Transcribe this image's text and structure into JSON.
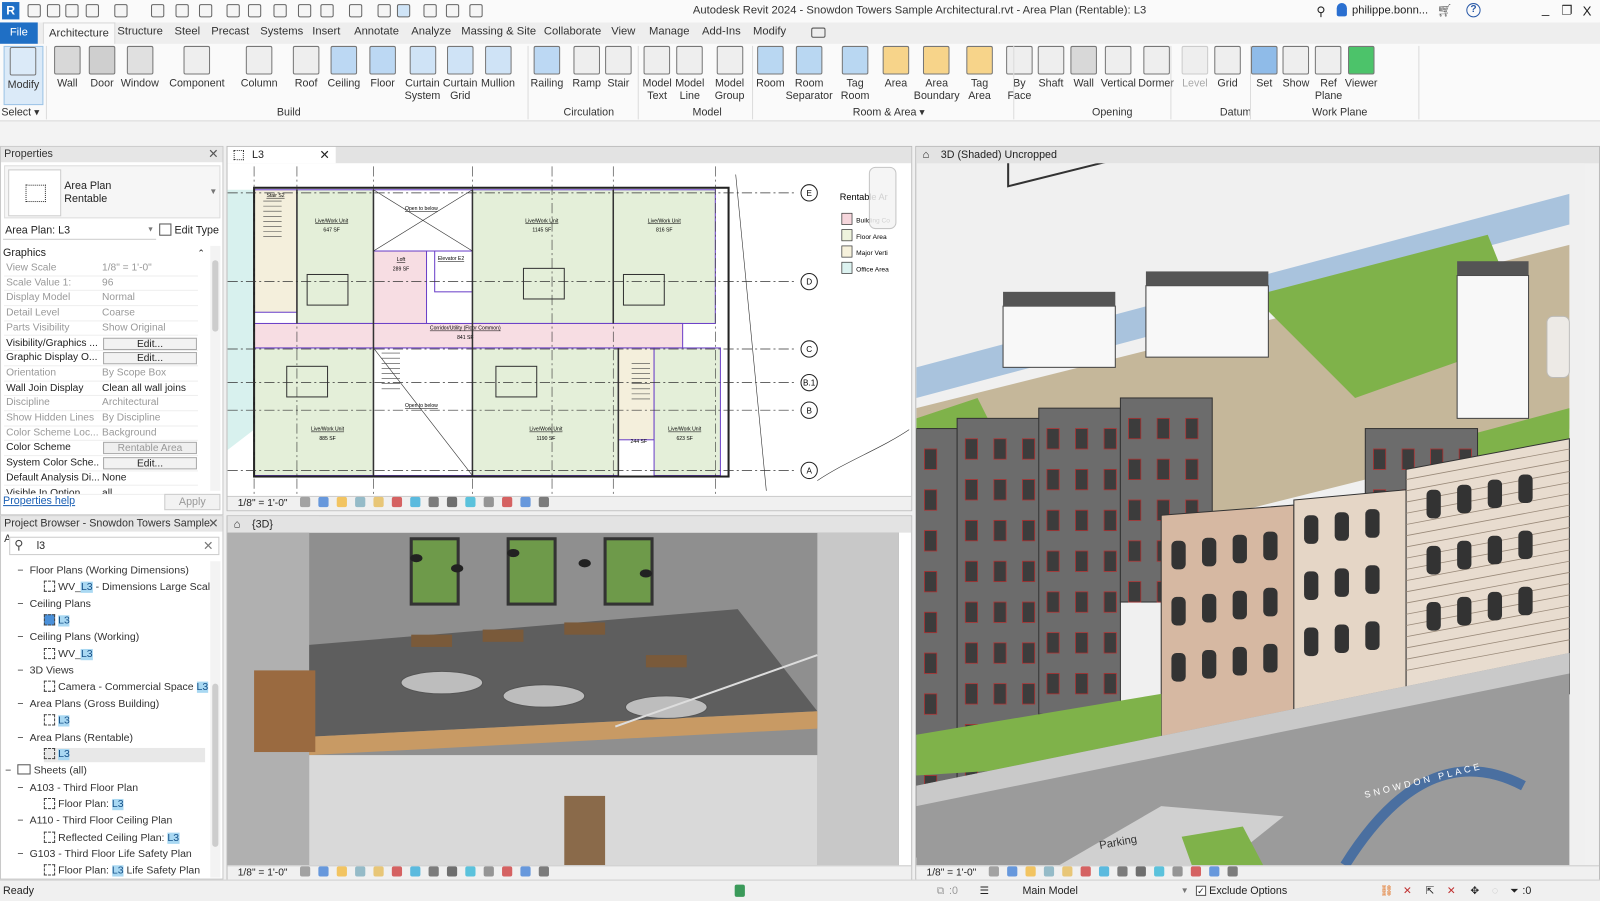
{
  "app": {
    "title": "Autodesk Revit 2024 - Snowdon Towers Sample Architectural.rvt - Area Plan (Rentable): L3",
    "logo": "R",
    "user": "philippe.bonn...",
    "icons": [
      "infocenter-binoculars-icon",
      "user-icon",
      "cart-icon",
      "help-icon"
    ]
  },
  "window_controls": {
    "minimize": "_",
    "restore": "❐",
    "close": "X"
  },
  "tabs": [
    "File",
    "Architecture",
    "Structure",
    "Steel",
    "Precast",
    "Systems",
    "Insert",
    "Annotate",
    "Analyze",
    "Massing & Site",
    "Collaborate",
    "View",
    "Manage",
    "Add-Ins",
    "Modify"
  ],
  "active_tab": "Architecture",
  "ribbon": {
    "buttons": [
      [
        "Modify",
        ""
      ],
      [
        "Wall",
        ""
      ],
      [
        "Door",
        ""
      ],
      [
        "Window",
        ""
      ],
      [
        "Component",
        ""
      ],
      [
        "Column",
        ""
      ],
      [
        "Roof",
        ""
      ],
      [
        "Ceiling",
        ""
      ],
      [
        "Floor",
        ""
      ],
      [
        "Curtain",
        "System"
      ],
      [
        "Curtain",
        "Grid"
      ],
      [
        "Mullion",
        ""
      ],
      [
        "Railing",
        ""
      ],
      [
        "Ramp",
        ""
      ],
      [
        "Stair",
        ""
      ],
      [
        "Model",
        "Text"
      ],
      [
        "Model",
        "Line"
      ],
      [
        "Model",
        "Group"
      ],
      [
        "Room",
        ""
      ],
      [
        "Room",
        "Separator"
      ],
      [
        "Tag",
        "Room"
      ],
      [
        "Area",
        ""
      ],
      [
        "Area",
        "Boundary"
      ],
      [
        "Tag",
        "Area"
      ],
      [
        "By",
        "Face"
      ],
      [
        "Shaft",
        ""
      ],
      [
        "Wall",
        ""
      ],
      [
        "Vertical",
        ""
      ],
      [
        "Dormer",
        ""
      ],
      [
        "Level",
        ""
      ],
      [
        "Grid",
        ""
      ],
      [
        "Set",
        ""
      ],
      [
        "Show",
        ""
      ],
      [
        "Ref",
        "Plane"
      ],
      [
        "Viewer",
        ""
      ]
    ],
    "panels": [
      "Select ▾",
      "Build",
      "Circulation",
      "Model",
      "Room & Area ▾",
      "Opening",
      "Datum",
      "Work Plane"
    ]
  },
  "properties": {
    "title": "Properties",
    "type_name_1": "Area Plan",
    "type_name_2": "Rentable",
    "instance": "Area Plan: L3",
    "edit_type": "Edit Type",
    "section": "Graphics",
    "rows": [
      {
        "label": "View Scale",
        "value": "1/8\" = 1'-0\"",
        "kind": "gray"
      },
      {
        "label": "Scale Value    1:",
        "value": "96",
        "kind": "gray"
      },
      {
        "label": "Display Model",
        "value": "Normal",
        "kind": "gray"
      },
      {
        "label": "Detail Level",
        "value": "Coarse",
        "kind": "gray"
      },
      {
        "label": "Parts Visibility",
        "value": "Show Original",
        "kind": "gray"
      },
      {
        "label": "Visibility/Graphics ...",
        "value": "Edit...",
        "kind": "button"
      },
      {
        "label": "Graphic Display O...",
        "value": "Edit...",
        "kind": "button"
      },
      {
        "label": "Orientation",
        "value": "By Scope Box",
        "kind": "gray"
      },
      {
        "label": "Wall Join Display",
        "value": "Clean all wall joins",
        "kind": "normal"
      },
      {
        "label": "Discipline",
        "value": "Architectural",
        "kind": "gray"
      },
      {
        "label": "Show Hidden Lines",
        "value": "By Discipline",
        "kind": "gray"
      },
      {
        "label": "Color Scheme Loc...",
        "value": "Background",
        "kind": "gray"
      },
      {
        "label": "Color Scheme",
        "value": "Rentable Area",
        "kind": "disabled-button"
      },
      {
        "label": "System Color Sche...",
        "value": "Edit...",
        "kind": "button"
      },
      {
        "label": "Default Analysis Di...",
        "value": "None",
        "kind": "normal"
      },
      {
        "label": "Visible In Option",
        "value": "all",
        "kind": "normal"
      }
    ],
    "help_link": "Properties help",
    "apply": "Apply"
  },
  "browser": {
    "title": "Project Browser - Snowdon Towers Sample A...",
    "search_value": "l3",
    "items": [
      {
        "level": 1,
        "pre": "Floor Plans (Working Dimensions)",
        "match": "",
        "post": "",
        "icon": "group"
      },
      {
        "level": 2,
        "pre": "WV_",
        "match": "L3",
        "post": " - Dimensions Large Scale",
        "icon": "view"
      },
      {
        "level": 1,
        "pre": "Ceiling Plans",
        "match": "",
        "post": "",
        "icon": "group"
      },
      {
        "level": 2,
        "pre": "",
        "match": "L3",
        "post": "",
        "icon": "view-active"
      },
      {
        "level": 1,
        "pre": "Ceiling Plans (Working)",
        "match": "",
        "post": "",
        "icon": "group"
      },
      {
        "level": 2,
        "pre": "WV_",
        "match": "L3",
        "post": "",
        "icon": "view"
      },
      {
        "level": 1,
        "pre": "3D Views",
        "match": "",
        "post": "",
        "icon": "group"
      },
      {
        "level": 2,
        "pre": "Camera - Commercial Space ",
        "match": "L3",
        "post": "",
        "icon": "view"
      },
      {
        "level": 1,
        "pre": "Area Plans (Gross Building)",
        "match": "",
        "post": "",
        "icon": "group"
      },
      {
        "level": 2,
        "pre": "",
        "match": "L3",
        "post": "",
        "icon": "view"
      },
      {
        "level": 1,
        "pre": "Area Plans (Rentable)",
        "match": "",
        "post": "",
        "icon": "group"
      },
      {
        "level": 2,
        "pre": "",
        "match": "L3",
        "post": "",
        "icon": "view",
        "selected": true
      },
      {
        "level": 0,
        "pre": "Sheets (all)",
        "match": "",
        "post": "",
        "icon": "sheets"
      },
      {
        "level": 1,
        "pre": "A103 - Third Floor Plan",
        "match": "",
        "post": "",
        "icon": "group"
      },
      {
        "level": 2,
        "pre": "Floor Plan: ",
        "match": "L3",
        "post": "",
        "icon": "sheet-view"
      },
      {
        "level": 1,
        "pre": "A110 - Third Floor Ceiling Plan",
        "match": "",
        "post": "",
        "icon": "group"
      },
      {
        "level": 2,
        "pre": "Reflected Ceiling Plan: ",
        "match": "L3",
        "post": "",
        "icon": "sheet-rcp"
      },
      {
        "level": 1,
        "pre": "G103 - Third Floor Life Safety Plan",
        "match": "",
        "post": "",
        "icon": "group"
      },
      {
        "level": 2,
        "pre": "Floor Plan: ",
        "match": "L3",
        "post": " Life Safety Plan",
        "icon": "sheet-view"
      }
    ]
  },
  "views": {
    "plan": {
      "tab": "L3",
      "scale": "1/8\" = 1'-0\"",
      "rooms": [
        {
          "name": "Stair S2",
          "area": ""
        },
        {
          "name": "Live/Work Unit",
          "area": "647 SF"
        },
        {
          "name": "Open to below",
          "area": ""
        },
        {
          "name": "Loft",
          "area": "289 SF"
        },
        {
          "name": "Elevator E2",
          "area": ""
        },
        {
          "name": "Live/Work Unit",
          "area": "1145 SF"
        },
        {
          "name": "Live/Work Unit",
          "area": "816 SF"
        },
        {
          "name": "Corridor/Utility (Floor Common)",
          "area": "841 SF"
        },
        {
          "name": "Live/Work Unit",
          "area": "885 SF"
        },
        {
          "name": "Open to below",
          "area": ""
        },
        {
          "name": "Live/Work Unit",
          "area": "1190 SF"
        },
        {
          "name": "",
          "area": "244 SF"
        },
        {
          "name": "Live/Work Unit",
          "area": "623 SF"
        }
      ],
      "grids": [
        "E",
        "D",
        "C",
        "B.1",
        "B",
        "A"
      ],
      "legend": {
        "title": "Rentable Ar",
        "items": [
          {
            "label": "Building Co",
            "color": "#f6d6dc"
          },
          {
            "label": "Floor Area",
            "color": "#eef3dd"
          },
          {
            "label": "Major Verti",
            "color": "#f6f1dc"
          },
          {
            "label": "Office Area",
            "color": "#dcf2f0"
          }
        ]
      },
      "colors": {
        "unit": "#e4efd9",
        "common": "#f7dde3",
        "stair": "#f4efdc",
        "office": "#d8f1ee",
        "boundary": "#6a3fc8"
      }
    },
    "camera": {
      "tab": "{3D}",
      "scale": "1/8\" = 1'-0\""
    },
    "model3d": {
      "tab": "3D (Shaded) Uncropped",
      "scale": "1/8\" = 1'-0\"",
      "sign": "SNOWDON PLACE",
      "parking": "Parking"
    }
  },
  "status": {
    "text": "Ready",
    "worksets": ":0",
    "design_option": "Main Model",
    "exclude_options": "Exclude Options",
    "filter_count": ":0"
  }
}
